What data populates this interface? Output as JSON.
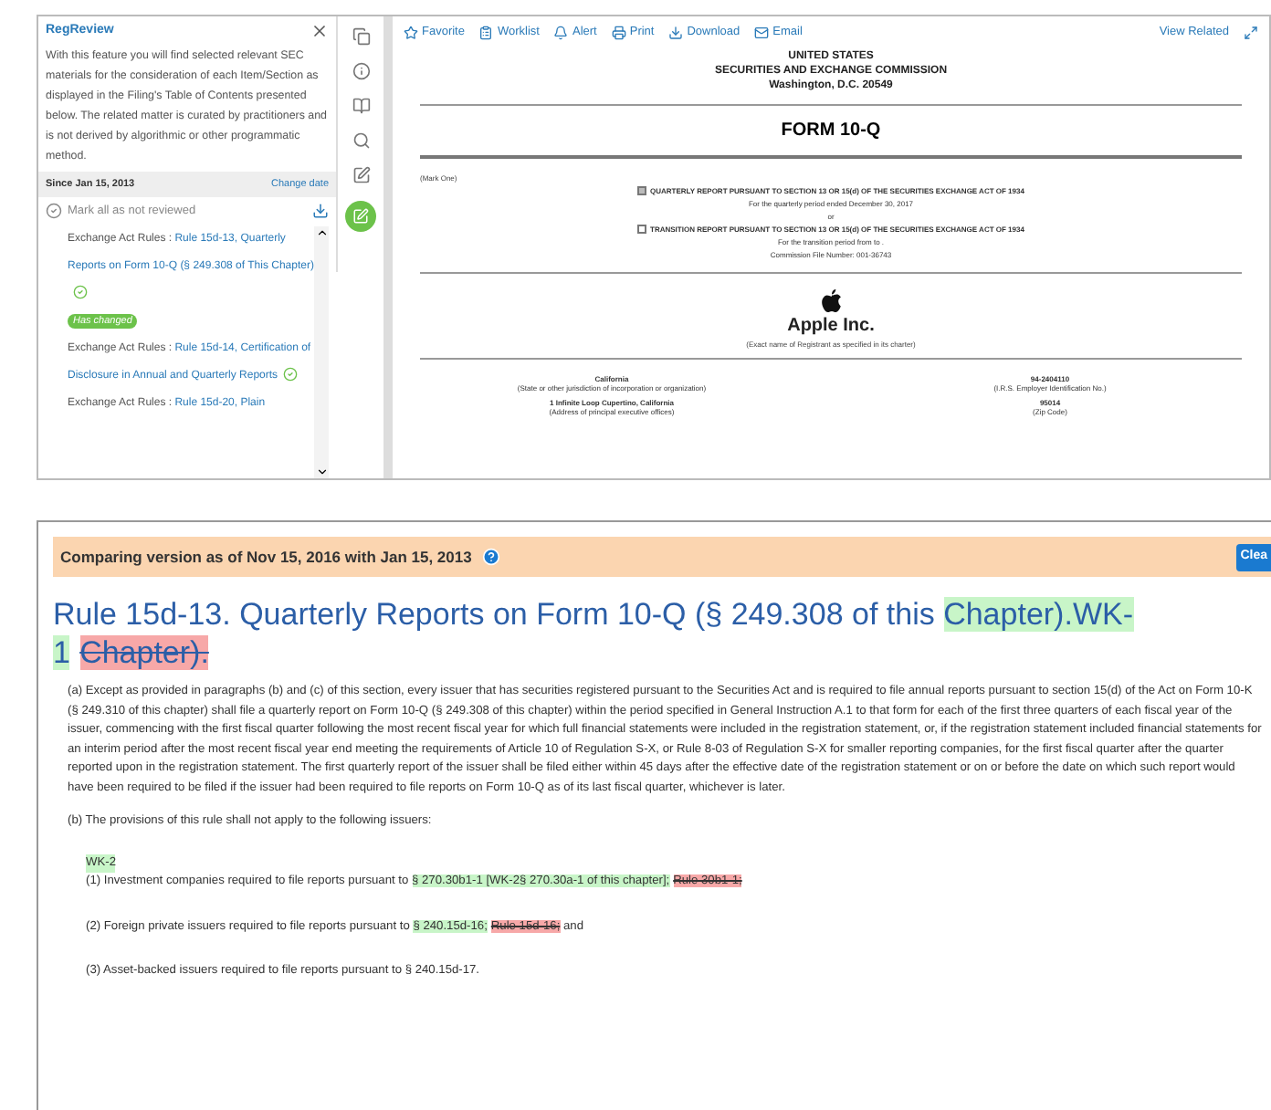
{
  "sidebar": {
    "title": "RegReview",
    "description": "With this feature you will find selected relevant SEC materials for the consideration of each Item/Section as displayed in the Filing's Table of Contents presented below. The related matter is curated by practitioners and is not derived by algorithmic or other programmatic method.",
    "since": "Since Jan 15, 2013",
    "change_date": "Change date",
    "mark_all": "Mark all as not reviewed",
    "items": [
      {
        "prefix": "Exchange Act Rules : ",
        "link": "Rule 15d-13, Quarterly Reports on Form 10-Q (§ 249.308 of This Chapter)",
        "reviewed": true,
        "badge": "Has changed"
      },
      {
        "prefix": "Exchange Act Rules : ",
        "link": "Rule 15d-14, Certification of Disclosure in Annual and Quarterly Reports",
        "reviewed": true
      },
      {
        "prefix": "Exchange Act Rules : ",
        "link": "Rule 15d-20, Plain",
        "reviewed": false
      }
    ]
  },
  "toolbar": {
    "actions": [
      "Favorite",
      "Worklist",
      "Alert",
      "Print",
      "Download",
      "Email"
    ],
    "view_related": "View Related"
  },
  "document": {
    "header": [
      "UNITED STATES",
      "SECURITIES AND EXCHANGE COMMISSION",
      "Washington, D.C. 20549"
    ],
    "form": "FORM 10-Q",
    "mark_one": "(Mark One)",
    "options": [
      {
        "checked": true,
        "label": "QUARTERLY REPORT PURSUANT TO SECTION 13 OR 15(d) OF THE SECURITIES EXCHANGE ACT OF 1934",
        "notes": [
          "For the quarterly period ended December 30, 2017",
          "or"
        ]
      },
      {
        "checked": false,
        "label": "TRANSITION REPORT PURSUANT TO SECTION 13 OR 15(d) OF THE SECURITIES EXCHANGE ACT OF 1934",
        "notes": [
          "For the transition period from to .",
          "Commission File Number: 001-36743"
        ]
      }
    ],
    "company": "Apple Inc.",
    "company_caption": "(Exact name of Registrant as specified in its charter)",
    "left_block": [
      {
        "value": "California",
        "caption": "(State or other jurisdiction of incorporation or organization)"
      },
      {
        "value": "1 Infinite Loop Cupertino, California",
        "caption": "(Address of principal executive offices)"
      }
    ],
    "right_block": [
      {
        "value": "94-2404110",
        "caption": "(I.R.S. Employer Identification No.)"
      },
      {
        "value": "95014",
        "caption": "(Zip Code)"
      }
    ]
  },
  "compare": {
    "banner": "Comparing version as of Nov 15, 2016 with Jan 15, 2013",
    "clear": "Clea",
    "title": [
      {
        "kind": "plain",
        "text": "Rule 15d-13. Quarterly Reports on Form 10-Q (§ 249.308 of this "
      },
      {
        "kind": "added",
        "text": "Chapter).WK-1"
      },
      {
        "kind": "removed",
        "text": "Chapter)."
      }
    ],
    "para_a": "(a) Except as provided in paragraphs (b) and (c) of this section, every issuer that has securities registered pursuant to the Securities Act and is required to file annual reports pursuant to section 15(d) of the Act on Form 10-K (§ 249.310 of this chapter) shall file a quarterly report on Form 10-Q (§ 249.308 of this chapter) within the period specified in General Instruction A.1 to that form for each of the first three quarters of each fiscal year of the issuer, commencing with the first fiscal quarter following the most recent fiscal year for which full financial statements were included in the registration statement, or, if the registration statement included financial statements for an interim period after the most recent fiscal year end meeting the requirements of Article 10 of Regulation S-X, or Rule 8-03 of Regulation S-X for smaller reporting companies, for the first fiscal quarter after the quarter reported upon in the registration statement. The first quarterly report of the issuer shall be filed either within 45 days after the effective date of the registration statement or on or before the date on which such report would have been required to be filed if the issuer had been required to file reports on Form 10-Q as of its last fiscal quarter, whichever is later.",
    "para_b": "(b) The provisions of this rule shall not apply to the following issuers:",
    "marker": "WK-2",
    "items": [
      [
        {
          "kind": "plain",
          "text": "(1) Investment companies required to file reports pursuant to "
        },
        {
          "kind": "added",
          "text": "§ 270.30b1-1 [WK-2§ 270.30a-1 of this chapter];"
        },
        {
          "kind": "removed",
          "text": "Rule 30b1-1;"
        }
      ],
      [
        {
          "kind": "plain",
          "text": "(2) Foreign private issuers required to file reports pursuant to "
        },
        {
          "kind": "added",
          "text": "§ 240.15d-16;"
        },
        {
          "kind": "removed",
          "text": "Rule 15d-16;"
        },
        {
          "kind": "plain",
          "text": " and"
        }
      ],
      [
        {
          "kind": "plain",
          "text": "(3) Asset-backed issuers required to file reports pursuant to § 240.15d-17."
        }
      ]
    ]
  }
}
